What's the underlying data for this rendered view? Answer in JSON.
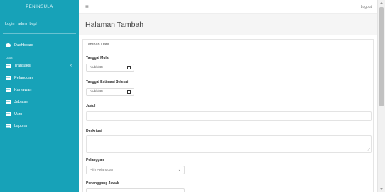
{
  "sidebar": {
    "brand": "PENINSULA",
    "user": "Login : admin bcpl",
    "dashboard": "Dashboard",
    "section": "Data",
    "items": [
      {
        "label": "Transaksi",
        "has_arrow": true
      },
      {
        "label": "Pelanggan"
      },
      {
        "label": "Karyawan"
      },
      {
        "label": "Jabatan"
      },
      {
        "label": "User"
      },
      {
        "label": "Laporan"
      }
    ]
  },
  "topbar": {
    "menu_icon": "≡",
    "logout": "Logout"
  },
  "page": {
    "title": "Halaman Tambah"
  },
  "form": {
    "card_title": "Tambah Data",
    "tanggal_mulai_label": "Tanggal Mulai",
    "tanggal_mulai_placeholder": "hh/bb/tttt",
    "tanggal_selesai_label": "Tanggal Estimasi Selesai",
    "tanggal_selesai_placeholder": "hh/bb/tttt",
    "judul_label": "Judul",
    "deskripsi_label": "Deskripsi",
    "pelanggan_label": "Pelanggan",
    "pelanggan_selected": "Pilih Pelanggan",
    "penanggung_label": "Penanggung Jawab"
  },
  "colors": {
    "sidebar": "#17a2b8"
  }
}
